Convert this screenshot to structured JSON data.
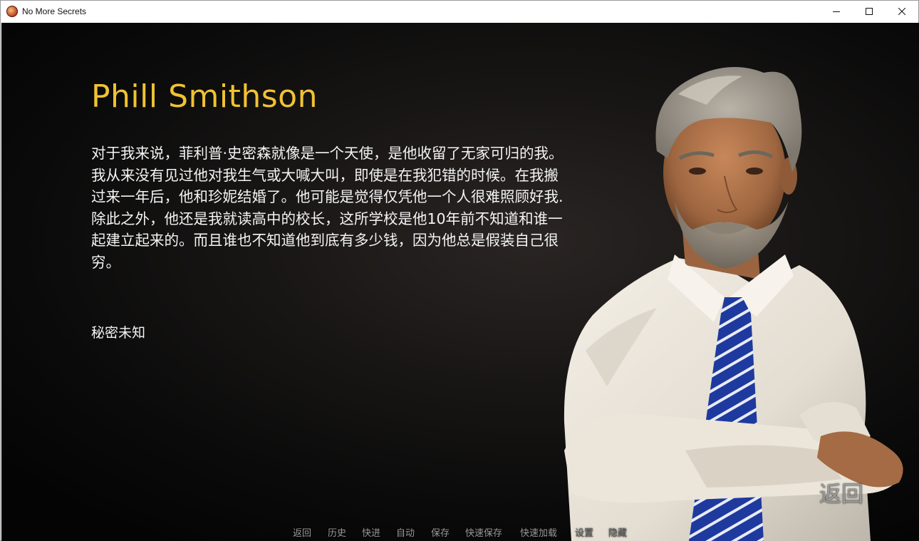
{
  "window": {
    "title": "No More Secrets",
    "icon": "app-icon",
    "controls": [
      "minimize-icon",
      "maximize-icon",
      "close-icon"
    ]
  },
  "profile": {
    "name": "Phill Smithson",
    "bio": "对于我来说，菲利普·史密森就像是一个天使，是他收留了无家可归的我。我从来没有见过他对我生气或大喊大叫，即使是在我犯错的时候。在我搬过来一年后，他和珍妮结婚了。他可能是觉得仅凭他一个人很难照顾好我. 除此之外，他还是我就读高中的校长，这所学校是他10年前不知道和谁一起建立起来的。而且谁也不知道他到底有多少钱，因为他总是假装自己很穷。",
    "secret_status": "秘密未知",
    "portrait": "character-portrait-bearded-man-white-shirt-blue-striped-tie"
  },
  "back_button": "返回",
  "quick_menu": [
    {
      "label": "返回",
      "enabled": true
    },
    {
      "label": "历史",
      "enabled": true
    },
    {
      "label": "快进",
      "enabled": true
    },
    {
      "label": "自动",
      "enabled": true
    },
    {
      "label": "保存",
      "enabled": true
    },
    {
      "label": "快速保存",
      "enabled": true
    },
    {
      "label": "快速加载",
      "enabled": true
    },
    {
      "label": "设置",
      "enabled": false
    },
    {
      "label": "隐藏",
      "enabled": false
    }
  ],
  "colors": {
    "name_accent": "#f1c232",
    "text": "#f4f4f4",
    "menu_text": "#9a9a9a",
    "menu_disabled": "#5a5a5a",
    "background": "#0a0a0a"
  }
}
